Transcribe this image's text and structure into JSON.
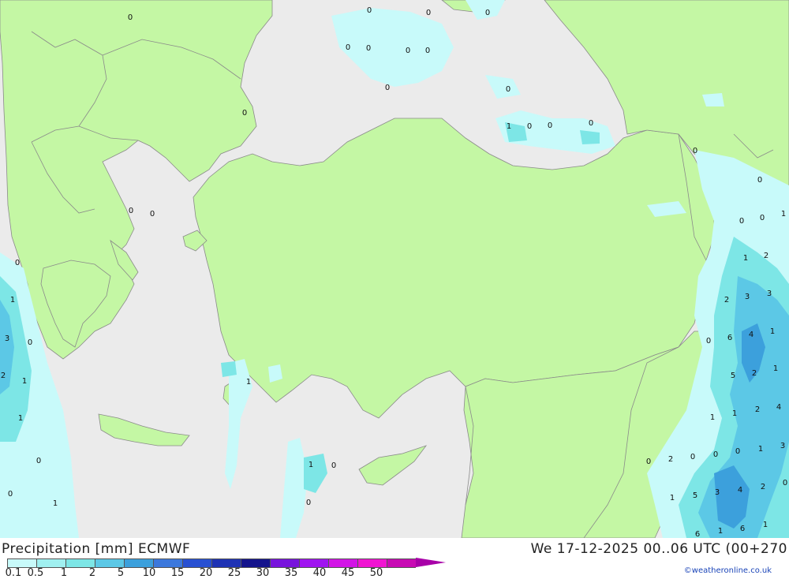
{
  "map": {
    "values": [
      {
        "v": "0"
      },
      {
        "v": "0"
      },
      {
        "v": "0"
      },
      {
        "v": "0"
      },
      {
        "v": "0"
      },
      {
        "v": "0"
      },
      {
        "v": "0"
      },
      {
        "v": "0"
      },
      {
        "v": "0"
      },
      {
        "v": "0"
      },
      {
        "v": "1"
      },
      {
        "v": "0"
      },
      {
        "v": "0"
      },
      {
        "v": "0"
      },
      {
        "v": "0"
      },
      {
        "v": "0"
      },
      {
        "v": "0"
      },
      {
        "v": "0"
      },
      {
        "v": "0"
      },
      {
        "v": "1"
      },
      {
        "v": "3"
      },
      {
        "v": "0"
      },
      {
        "v": "2"
      },
      {
        "v": "1"
      },
      {
        "v": "1"
      },
      {
        "v": "0"
      },
      {
        "v": "1"
      },
      {
        "v": "0"
      },
      {
        "v": "1"
      },
      {
        "v": "1"
      },
      {
        "v": "0"
      },
      {
        "v": "0"
      },
      {
        "v": "0"
      },
      {
        "v": "0"
      },
      {
        "v": "0"
      },
      {
        "v": "1"
      },
      {
        "v": "2"
      },
      {
        "v": "1"
      },
      {
        "v": "2"
      },
      {
        "v": "3"
      },
      {
        "v": "3"
      },
      {
        "v": "6"
      },
      {
        "v": "4"
      },
      {
        "v": "1"
      },
      {
        "v": "0"
      },
      {
        "v": "5"
      },
      {
        "v": "2"
      },
      {
        "v": "1"
      },
      {
        "v": "1"
      },
      {
        "v": "1"
      },
      {
        "v": "2"
      },
      {
        "v": "4"
      },
      {
        "v": "0"
      },
      {
        "v": "2"
      },
      {
        "v": "0"
      },
      {
        "v": "0"
      },
      {
        "v": "0"
      },
      {
        "v": "1"
      },
      {
        "v": "3"
      },
      {
        "v": "1"
      },
      {
        "v": "5"
      },
      {
        "v": "3"
      },
      {
        "v": "4"
      },
      {
        "v": "2"
      },
      {
        "v": "0"
      },
      {
        "v": "6"
      },
      {
        "v": "1"
      },
      {
        "v": "6"
      },
      {
        "v": "1"
      }
    ]
  },
  "footer": {
    "title": "Precipitation [mm] ECMWF",
    "datetime": "We 17-12-2025 00..06 UTC (00+270",
    "credit": "©weatheronline.co.uk"
  },
  "legend": {
    "colors": [
      "#c8fafa",
      "#a0f0f0",
      "#7de6e6",
      "#5cc8e6",
      "#3ca0dc",
      "#3c78dc",
      "#2850d2",
      "#1e32b4",
      "#14148c",
      "#7814dc",
      "#a014f0",
      "#d214e6",
      "#f014d2",
      "#c80ab4"
    ],
    "arrow_color": "#a800a8",
    "ticks": [
      "0.1",
      "0.5",
      "1",
      "2",
      "5",
      "10",
      "15",
      "20",
      "25",
      "30",
      "35",
      "40",
      "45",
      "50"
    ]
  },
  "colors": {
    "sea": "#ebebeb",
    "land": "#c4f7a4",
    "border": "#8a8a8a",
    "precip_light": "#c8fafa",
    "precip_mid": "#7de6e6",
    "precip_heavy": "#3ca0dc"
  }
}
